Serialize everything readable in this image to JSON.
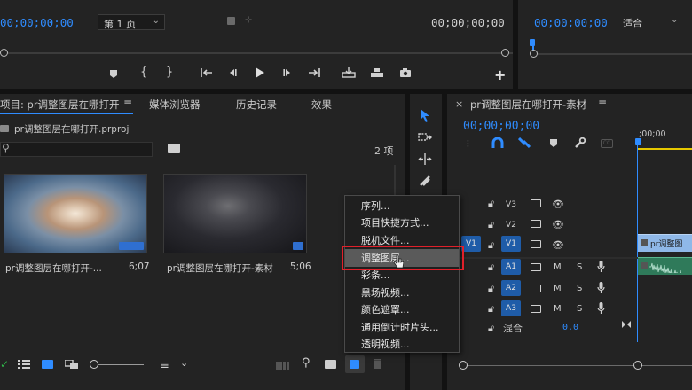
{
  "source_monitor": {
    "timecode_in": "00;00;00;00",
    "page_select": "第 1 页",
    "timecode_out": "00;00;00;00"
  },
  "program_monitor": {
    "timecode": "00;00;00;00",
    "fit_select": "适合"
  },
  "project_panel": {
    "tabs": [
      "项目: pr调整图层在哪打开",
      "媒体浏览器",
      "历史记录",
      "效果"
    ],
    "project_file": "pr调整图层在哪打开.prproj",
    "item_count": "2 项",
    "search_placeholder": "",
    "clips": [
      {
        "name": "pr调整图层在哪打开-...",
        "duration": "6;07"
      },
      {
        "name": "pr调整图层在哪打开-素材",
        "duration": "5;06"
      }
    ]
  },
  "timeline": {
    "title": "pr调整图层在哪打开-素材",
    "timecode": "00;00;00;00",
    "ruler_start": ";00;00",
    "video_tracks": [
      "V3",
      "V2",
      "V1"
    ],
    "audio_tracks": [
      "A1",
      "A2",
      "A3"
    ],
    "source_patch_v": "V1",
    "mix_label": "混合",
    "mix_value": "0.0",
    "clip_label": "pr调整图",
    "track_buttons": {
      "mute": "M",
      "solo": "S"
    }
  },
  "context_menu": {
    "items": [
      "序列...",
      "项目快捷方式...",
      "脱机文件...",
      "调整图层...",
      "彩条...",
      "黑场视频...",
      "颜色遮罩...",
      "通用倒计时片头...",
      "透明视频..."
    ],
    "highlighted_index": 3
  },
  "colors": {
    "accent": "#2f8cff",
    "highlight_border": "#e0202a",
    "playhead_line": "#e6c800"
  }
}
